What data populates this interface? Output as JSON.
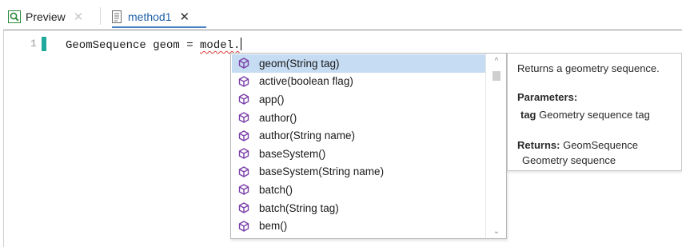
{
  "tabs": [
    {
      "label": "Preview",
      "icon": "preview-icon",
      "close": "✕"
    },
    {
      "label": "method1",
      "icon": "method-file-icon",
      "close": "✕"
    }
  ],
  "editor": {
    "line_number": "1",
    "code_before": "GeomSequence geom = ",
    "code_squiggle": "model.",
    "change_marker_color": "#1fa89c"
  },
  "autocomplete": {
    "item_icon": "method-cube-icon",
    "selected_index": 0,
    "items": [
      "geom(String tag)",
      "active(boolean flag)",
      "app()",
      "author()",
      "author(String name)",
      "baseSystem()",
      "baseSystem(String name)",
      "batch()",
      "batch(String tag)",
      "bem()"
    ],
    "scroll_up": "^",
    "scroll_down": "⌄"
  },
  "doc": {
    "summary": "Returns a geometry sequence.",
    "parameters_heading": "Parameters:",
    "param_name": "tag",
    "param_desc": "Geometry sequence tag",
    "returns_label": "Returns:",
    "returns_type": "GeomSequence",
    "returns_desc": "Geometry sequence"
  },
  "colors": {
    "selection": "#c6dcf2",
    "active_tab_text": "#1f5fa8",
    "icon_purple": "#7a3fa8"
  }
}
